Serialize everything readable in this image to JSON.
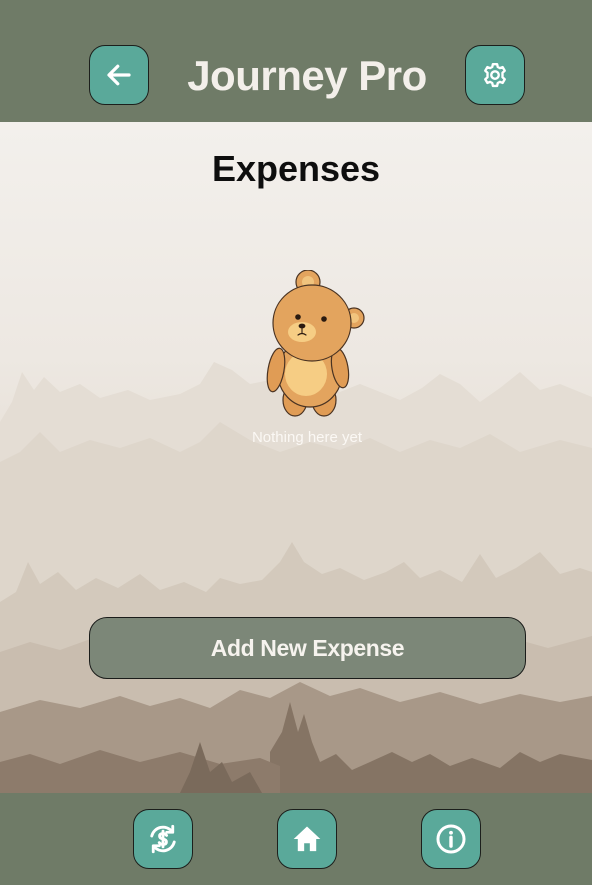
{
  "header": {
    "title": "Journey Pro",
    "back_icon": "arrow-left-icon",
    "settings_icon": "gear-icon"
  },
  "main": {
    "page_title": "Expenses",
    "empty_state": {
      "illustration": "teddy-bear",
      "message": "Nothing here yet"
    },
    "add_button_label": "Add New Expense"
  },
  "footer": {
    "nav": [
      {
        "icon": "currency-exchange-icon"
      },
      {
        "icon": "home-icon"
      },
      {
        "icon": "info-icon"
      }
    ]
  },
  "colors": {
    "bar_bg": "#6f7b67",
    "icon_button": "#5aa99a",
    "add_button": "#7c8778",
    "page_bg": "#f2efeb",
    "title_text": "#f3efea"
  }
}
